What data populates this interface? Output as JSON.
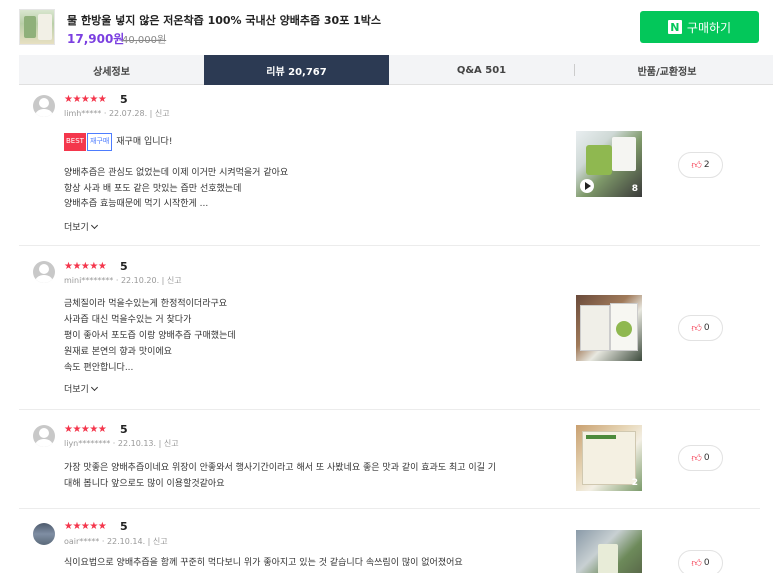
{
  "product": {
    "title": "물 한방울 넣지 않은 저온착즙 100% 국내산 양배추즙 30포 1박스",
    "price": "17,900원",
    "original_price": "40,000원",
    "buy_label": "구매하기",
    "buy_icon": "N"
  },
  "tabs": [
    {
      "label": "상세정보",
      "active": false
    },
    {
      "label": "리뷰 20,767",
      "active": true
    },
    {
      "label": "Q&A 501",
      "active": false
    },
    {
      "label": "반품/교환정보",
      "active": false
    }
  ],
  "reviews": [
    {
      "stars": "★★★★★",
      "score": "5",
      "user": "limh*****",
      "date": "22.07.28.",
      "report": "신고",
      "badges": {
        "best": "BEST",
        "repurchase": "재구매"
      },
      "headline": "재구매 입니다!",
      "lines": [
        "양배추즙은 관심도 없었는데 이제 이거만 시켜먹을거 같아요",
        "항상 사과 배 포도 같은 맛있는 즙만 선호했는데",
        "양배추즙 효능때문에 먹기 시작한게 ..."
      ],
      "more_label": "더보기",
      "photo_count": "8",
      "likes": "2"
    },
    {
      "stars": "★★★★★",
      "score": "5",
      "user": "mini********",
      "date": "22.10.20.",
      "report": "신고",
      "lines": [
        "금체질이라 먹을수있는게 한정적이더라구요",
        "사과즙 대신 먹을수있는 거 찾다가",
        "평이 좋아서 포도즙 이랑 양배추즙 구매했는데",
        "원재료 본연의 향과 맛이에요",
        "속도 편안합니다..."
      ],
      "more_label": "더보기",
      "likes": "0"
    },
    {
      "stars": "★★★★★",
      "score": "5",
      "user": "liyn********",
      "date": "22.10.13.",
      "report": "신고",
      "lines": [
        "가장 맛좋은 양배추즙이네요 위장이 안좋와서 행사기간이라고 해서 또 사봤네요 좋은 맛과 같이 효과도 최고 이길 기",
        "대해 봅니다 앞으로도 많이 이용할것같아요"
      ],
      "photo_count": "2",
      "likes": "0"
    },
    {
      "stars": "★★★★★",
      "score": "5",
      "user": "oair*****",
      "date": "22.10.14.",
      "report": "신고",
      "lines": [
        "식이요법으로 양배추즙을 함께 꾸준히 먹다보니 위가 좋아지고 있는 것 같습니다 속쓰림이 많이 없어졌어요"
      ],
      "likes": "0"
    }
  ]
}
